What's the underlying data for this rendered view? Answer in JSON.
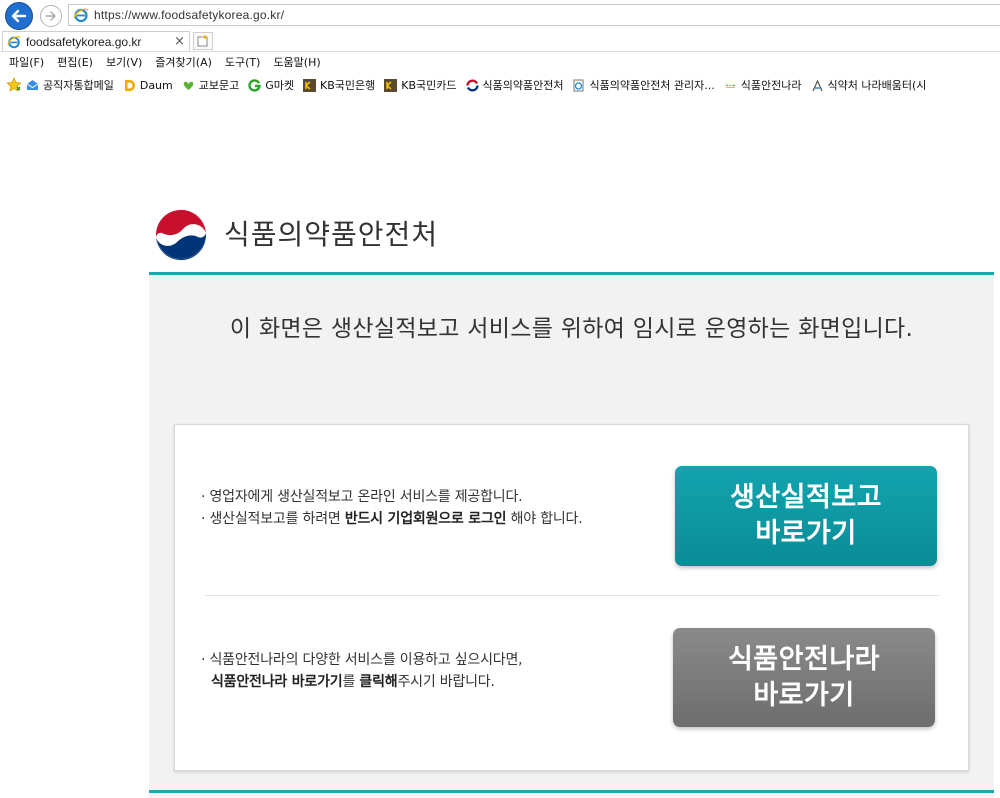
{
  "browser": {
    "url": "https://www.foodsafetykorea.go.kr/",
    "tab_title": "foodsafetykorea.go.kr",
    "tab_close": "×",
    "menu": [
      "파일(F)",
      "편집(E)",
      "보기(V)",
      "즐겨찾기(A)",
      "도구(T)",
      "도움말(H)"
    ],
    "favorites": [
      {
        "label": "공직자통합메일",
        "icon": "mail-icon"
      },
      {
        "label": "Daum",
        "icon": "daum-icon"
      },
      {
        "label": "교보문고",
        "icon": "kyobo-icon"
      },
      {
        "label": "G마켓",
        "icon": "gmarket-icon"
      },
      {
        "label": "KB국민은행",
        "icon": "kb-bank-icon"
      },
      {
        "label": "KB국민카드",
        "icon": "kb-card-icon"
      },
      {
        "label": "식품의약품안전처",
        "icon": "mfds-icon"
      },
      {
        "label": "식품의약품안전처 관리자...",
        "icon": "page-icon"
      },
      {
        "label": "식품안전나라",
        "icon": "foodsafety-icon"
      },
      {
        "label": "식약처 나라배움터(시",
        "icon": "academy-icon"
      }
    ]
  },
  "page": {
    "org_name": "식품의약품안전처",
    "headline": "이 화면은 생산실적보고 서비스를 위하여 임시로 운영하는 화면입니다.",
    "section1": {
      "line1": "· 영업자에게 생산실적보고 온라인 서비스를 제공합니다.",
      "line2_pre": "· 생산실적보고를 하려면 ",
      "line2_bold": "반드시 기업회원으로 로그인",
      "line2_post": " 해야 합니다.",
      "button_line1": "생산실적보고",
      "button_line2": "바로가기"
    },
    "section2": {
      "line1": "· 식품안전나라의 다양한 서비스를 이용하고 싶으시다면,",
      "line2_bold1": "식품안전나라 바로가기",
      "line2_mid": "를 ",
      "line2_bold2": "클릭해",
      "line2_post": "주시기 바랍니다.",
      "button_line1": "식품안전나라",
      "button_line2": "바로가기"
    }
  },
  "colors": {
    "accent_teal": "#1ba8ac",
    "primary_button": "#0a8c98",
    "secondary_button": "#777777",
    "logo_red": "#c8102e",
    "logo_blue": "#003478"
  }
}
